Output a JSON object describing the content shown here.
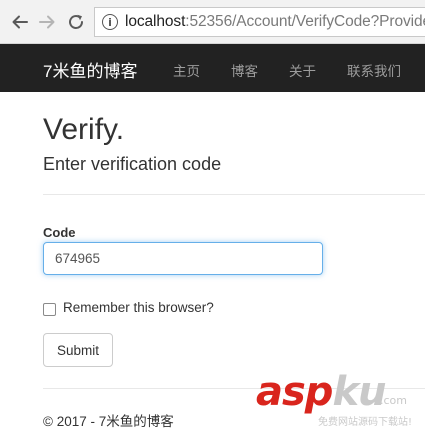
{
  "browser": {
    "url_host": "localhost",
    "url_rest": ":52356/Account/VerifyCode?Provide"
  },
  "navbar": {
    "brand": "7米鱼的博客",
    "links": [
      "主页",
      "博客",
      "关于",
      "联系我们"
    ]
  },
  "page": {
    "title": "Verify.",
    "subtitle": "Enter verification code"
  },
  "form": {
    "code_label": "Code",
    "code_value": "674965",
    "remember_label": "Remember this browser?",
    "remember_checked": false,
    "submit_label": "Submit"
  },
  "footer": {
    "text": "© 2017 - 7米鱼的博客"
  },
  "watermark": {
    "red_part": "asp",
    "grey_part": "ku",
    "suffix": ".com",
    "tagline": "免费网站源码下载站!"
  },
  "colors": {
    "navbar_bg": "#222222",
    "focus_border": "#66afe9",
    "watermark_red": "#d9251d"
  }
}
